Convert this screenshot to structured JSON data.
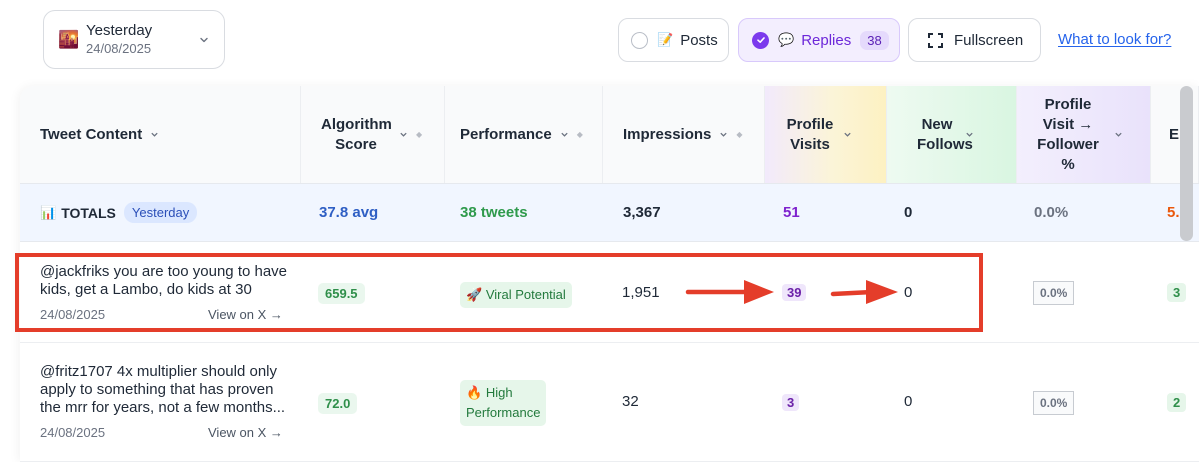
{
  "date_picker": {
    "emoji": "🌇",
    "label": "Yesterday",
    "date": "24/08/2025"
  },
  "filters": {
    "posts": {
      "emoji": "📝",
      "label": "Posts"
    },
    "replies": {
      "emoji": "💬",
      "label": "Replies",
      "count": "38"
    },
    "fullscreen": {
      "label": "Fullscreen"
    },
    "help_link": "What to look for?"
  },
  "table": {
    "headers": [
      "Tweet Content",
      "Algorithm Score",
      "Performance",
      "Impressions",
      "Profile Visits",
      "New Follows",
      "Profile Visit → Follower %",
      "E"
    ],
    "totals": {
      "emoji": "📊",
      "label": "TOTALS",
      "period": "Yesterday",
      "algorithm_score": "37.8 avg",
      "performance": "38 tweets",
      "impressions": "3,367",
      "profile_visits": "51",
      "new_follows": "0",
      "follower_pct": "0.0%",
      "last_col": "5."
    },
    "rows": [
      {
        "text": "@jackfriks you are too young to have kids, get a Lambo, do kids at 30",
        "date": "24/08/2025",
        "view_link": "View on X →",
        "algorithm_score": "659.5",
        "performance_emoji": "🚀",
        "performance": "Viral Potential",
        "impressions": "1,951",
        "profile_visits": "39",
        "new_follows": "0",
        "follower_pct": "0.0%",
        "last_col": "3"
      },
      {
        "text": "@fritz1707 4x multiplier should only apply to something that has proven the mrr for years, not a few months...",
        "date": "24/08/2025",
        "view_link": "View on X →",
        "algorithm_score": "72.0",
        "performance_emoji": "🔥",
        "performance_line1": "High",
        "performance_line2": "Performance",
        "impressions": "32",
        "profile_visits": "3",
        "new_follows": "0",
        "follower_pct": "0.0%",
        "last_col": "2"
      }
    ]
  },
  "colors": {
    "accent_purple": "#7c3aed",
    "link_blue": "#2563eb",
    "annotation_red": "#e43d2a",
    "avg_blue": "#2f5fc4",
    "tweets_green": "#2f9a4c",
    "visits_purple": "#7e22ce",
    "last_col_orange": "#ea580c"
  }
}
